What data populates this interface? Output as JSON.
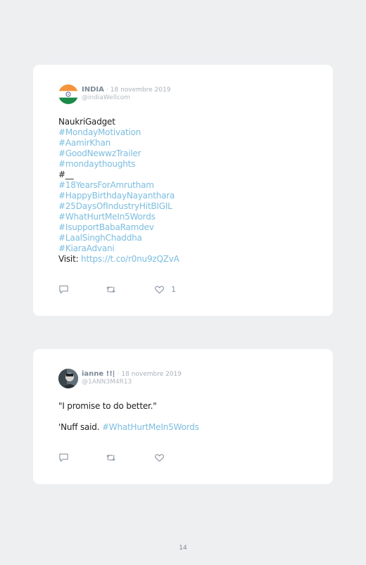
{
  "tweets": [
    {
      "name": "INDIA",
      "date": "· 18 novembre 2019",
      "handle": "@indiaWellcom",
      "lines": [
        {
          "text": "NaukriGadget",
          "link": false
        },
        {
          "text": "#MondayMotivation",
          "link": true
        },
        {
          "text": "#AamirKhan",
          "link": true
        },
        {
          "text": "#GoodNewwzTrailer",
          "link": true
        },
        {
          "text": "#mondaythoughts",
          "link": true
        },
        {
          "text": "#__",
          "link": false
        },
        {
          "text": "#18YearsForAmrutham",
          "link": true
        },
        {
          "text": "#HappyBirthdayNayanthara",
          "link": true
        },
        {
          "text": "#25DaysOfIndustryHitBIGIL",
          "link": true
        },
        {
          "text": "#WhatHurtMeIn5Words",
          "link": true
        },
        {
          "text": "#IsupportBabaRamdev",
          "link": true
        },
        {
          "text": "#LaalSinghChaddha",
          "link": true
        },
        {
          "text": "#KiaraAdvani",
          "link": true
        }
      ],
      "visit_label": "Visit:",
      "visit_url": "https://t.co/r0nu9zQZvA",
      "like_count": "1"
    },
    {
      "name": "ianne !!|",
      "date": "· 18 novembre 2019",
      "handle": "@1ANN3M4R13",
      "quote": "\"I promise to do better.\"",
      "closing": "'Nuff said.",
      "hashtag": "#WhatHurtMeIn5Words"
    }
  ],
  "page_number": "14",
  "icons": {
    "reply": "speech-bubble-icon",
    "retweet": "retweet-icon",
    "like": "heart-icon"
  },
  "colors": {
    "link": "#7bbde0",
    "background": "#eeeff1",
    "card": "#ffffff",
    "saffron": "#f3953b",
    "green": "#1a8a48"
  }
}
